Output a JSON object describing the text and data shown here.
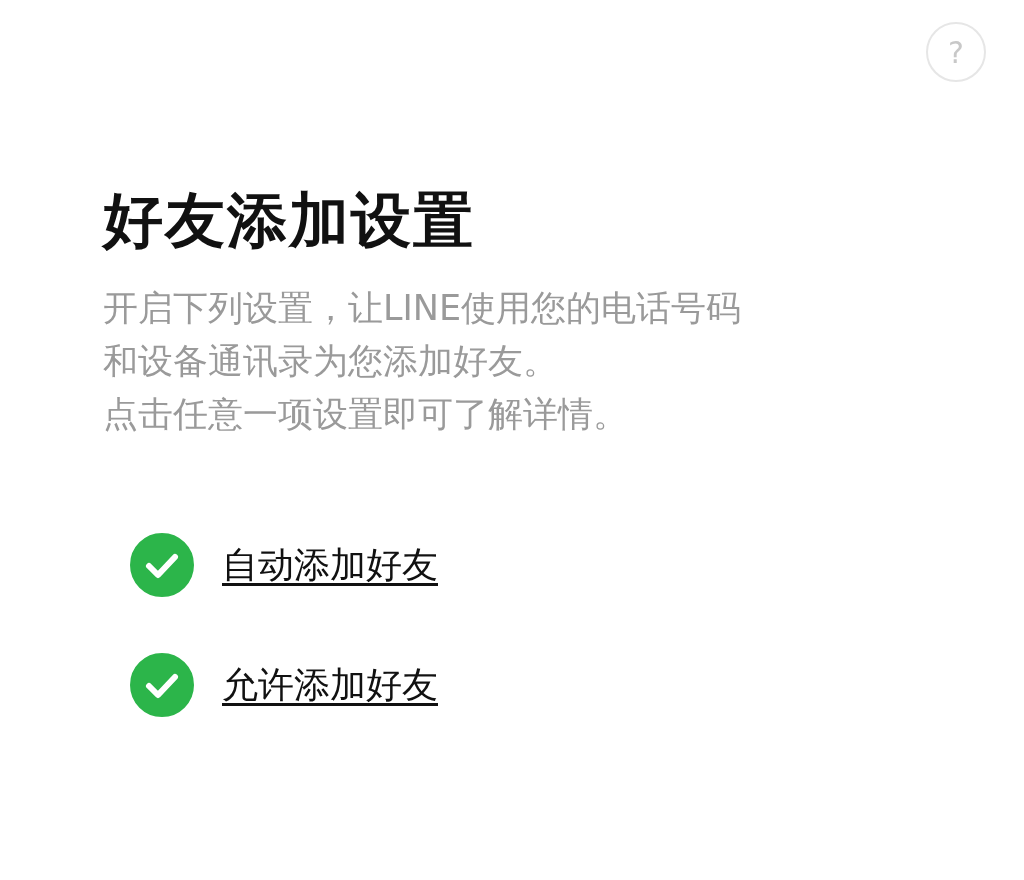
{
  "help_button": {
    "label": "?"
  },
  "title": "好友添加设置",
  "description": [
    "开启下列设置，让LINE使用您的电话号码",
    "和设备通讯录为您添加好友。",
    "点击任意一项设置即可了解详情。"
  ],
  "settings": [
    {
      "label": "自动添加好友",
      "checked": true
    },
    {
      "label": "允许添加好友",
      "checked": true
    }
  ]
}
